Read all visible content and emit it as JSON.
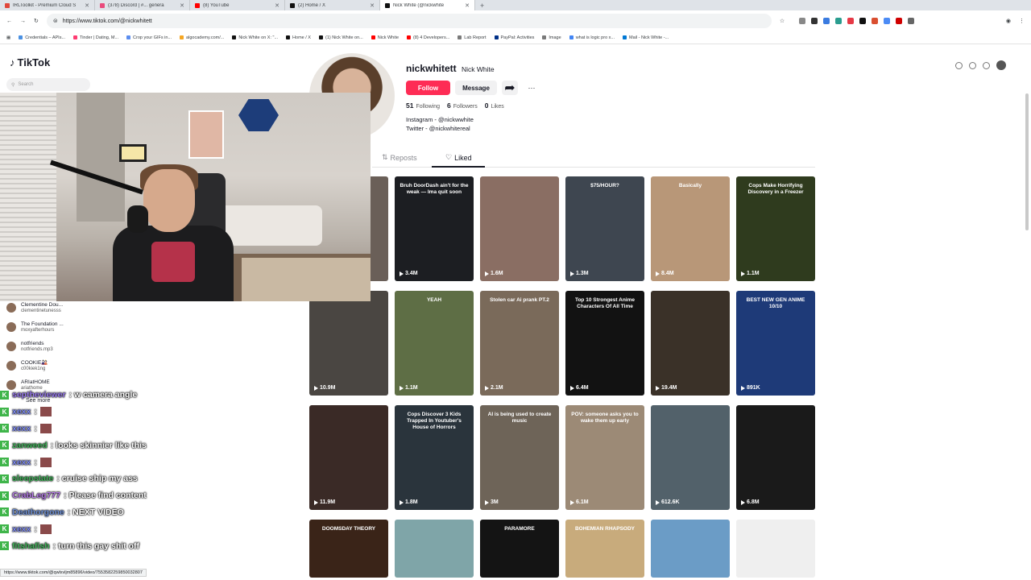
{
  "browser": {
    "tabs": [
      {
        "title": "IRLToolkit - Premium Cloud S",
        "color": "#e0463a",
        "active": false
      },
      {
        "title": "(378) Discord | #... genera",
        "color": "#e94a7c",
        "active": false
      },
      {
        "title": "(8) YouTube",
        "color": "#ff0000",
        "active": false
      },
      {
        "title": "(2) Home / X",
        "color": "#111111",
        "active": false
      },
      {
        "title": "Nick White (@nickwhite",
        "color": "#111111",
        "active": true
      }
    ],
    "url": "https://www.tiktok.com/@nickwhitett",
    "bookmarks": [
      {
        "label": "Credentials – APIs...",
        "color": "#4a90e2"
      },
      {
        "label": "Tinder | Dating, M...",
        "color": "#fe3c72"
      },
      {
        "label": "Crop your GIFs in...",
        "color": "#5b8def"
      },
      {
        "label": "algocademy.com/...",
        "color": "#f5a623"
      },
      {
        "label": "Nick White on X: \"...",
        "color": "#111111"
      },
      {
        "label": "Home / X",
        "color": "#111111"
      },
      {
        "label": "(1) Nick White on...",
        "color": "#111111"
      },
      {
        "label": "Nick White",
        "color": "#ff0000"
      },
      {
        "label": "(8) 4 Developers...",
        "color": "#ff0000"
      },
      {
        "label": "Lab Report",
        "color": "#7a7a7a"
      },
      {
        "label": "PayPal: Activities",
        "color": "#003087"
      },
      {
        "label": "Image",
        "color": "#7a7a7a"
      },
      {
        "label": "what is logic pro x...",
        "color": "#4285f4"
      },
      {
        "label": "Mail - Nick White -...",
        "color": "#0078d4"
      }
    ]
  },
  "tiktok": {
    "logo": "TikTok",
    "search_placeholder": "Search",
    "following_accounts": [
      {
        "name": "Clementine Dou...",
        "handle": "clementinetunesss"
      },
      {
        "name": "The Foundation ...",
        "handle": "moxyafterhours"
      },
      {
        "name": "notfriends",
        "handle": "notfriends.mp3"
      },
      {
        "name": "COOKIE🎎",
        "handle": "c00kiek1ng"
      },
      {
        "name": "ARIatHOME",
        "handle": "ariathome"
      }
    ],
    "see_more": "See more"
  },
  "profile": {
    "username": "nickwhitett",
    "display_name": "Nick White",
    "follow_label": "Follow",
    "message_label": "Message",
    "following_count": "51",
    "following_label": "Following",
    "followers_count": "6",
    "followers_label": "Followers",
    "likes_count": "0",
    "likes_label": "Likes",
    "bio_line1": "Instagram - @nickwwhite",
    "bio_line2": "Twitter - @nickwhitereal",
    "tab_reposts": "Reposts",
    "tab_liked": "Liked"
  },
  "videos": [
    {
      "views": "",
      "caption": "",
      "color": "#6a5f58"
    },
    {
      "views": "3.4M",
      "caption": "Bruh DoorDash ain't for the weak — Ima quit soon",
      "color": "#1c1e22"
    },
    {
      "views": "1.6M",
      "caption": "",
      "color": "#8a6e63"
    },
    {
      "views": "1.3M",
      "caption": "$75/HOUR?",
      "color": "#3e4650"
    },
    {
      "views": "8.4M",
      "caption": "Basically",
      "color": "#b89778"
    },
    {
      "views": "1.1M",
      "caption": "Cops Make Horrifying Discovery in a Freezer",
      "color": "#2f3b1e"
    },
    {
      "views": "10.9M",
      "caption": "",
      "color": "#4a4642"
    },
    {
      "views": "1.1M",
      "caption": "YEAH",
      "color": "#5e6e45"
    },
    {
      "views": "2.1M",
      "caption": "Stolen car Ai prank PT.2",
      "color": "#7a6a5a"
    },
    {
      "views": "6.4M",
      "caption": "Top 10 Strongest Anime Characters Of All Time",
      "color": "#121212"
    },
    {
      "views": "19.4M",
      "caption": "",
      "color": "#3a3128"
    },
    {
      "views": "891K",
      "caption": "BEST NEW GEN ANIME 10/10",
      "color": "#1e3a78"
    },
    {
      "views": "11.9M",
      "caption": "",
      "color": "#3a2a26"
    },
    {
      "views": "1.8M",
      "caption": "Cops Discover 3 Kids Trapped In Youtuber's House of Horrors",
      "color": "#2a343c"
    },
    {
      "views": "3M",
      "caption": "AI is being used to create music",
      "color": "#6e6458"
    },
    {
      "views": "6.1M",
      "caption": "POV: someone asks you to wake them up early",
      "color": "#9c8a76"
    },
    {
      "views": "612.6K",
      "caption": "",
      "color": "#52616a"
    },
    {
      "views": "6.8M",
      "caption": "",
      "color": "#1a1a1a"
    },
    {
      "views": "",
      "caption": "DOOMSDAY THEORY",
      "color": "#3a2418"
    },
    {
      "views": "",
      "caption": "",
      "color": "#7fa5a8"
    },
    {
      "views": "",
      "caption": "PARAMORE",
      "color": "#141414"
    },
    {
      "views": "",
      "caption": "BOHEMIAN RHAPSODY",
      "color": "#c8ab7c"
    },
    {
      "views": "",
      "caption": "",
      "color": "#6b9cc6"
    },
    {
      "views": "",
      "caption": "",
      "color": "#efefef"
    }
  ],
  "chat": [
    {
      "user": "septheviewer",
      "user_color": "#9b7cf0",
      "msg": ": w camera angle",
      "emote": false
    },
    {
      "user": "xexx",
      "user_color": "#7f8cf5",
      "msg": ":",
      "emote": true
    },
    {
      "user": "xexx",
      "user_color": "#7f8cf5",
      "msg": ":",
      "emote": true
    },
    {
      "user": "zanweed",
      "user_color": "#41b35a",
      "msg": ": looks skinnier like this",
      "emote": false
    },
    {
      "user": "xexx",
      "user_color": "#7f8cf5",
      "msg": ":",
      "emote": true
    },
    {
      "user": "sleepstate",
      "user_color": "#41b35a",
      "msg": ": cruise ship my ass",
      "emote": false
    },
    {
      "user": "CrabLeg777",
      "user_color": "#b57ae8",
      "msg": ": Please find content",
      "emote": false
    },
    {
      "user": "Deathorgone",
      "user_color": "#6d8fd6",
      "msg": ": NEXT VIDEO",
      "emote": false
    },
    {
      "user": "xexx",
      "user_color": "#7f8cf5",
      "msg": ":",
      "emote": true
    },
    {
      "user": "fitshafish",
      "user_color": "#41b35a",
      "msg": ": turn this gay shit off",
      "emote": false
    }
  ],
  "status_url": "https://www.tiktok.com/@qwlxvljm85896/video/7553582259850032807"
}
